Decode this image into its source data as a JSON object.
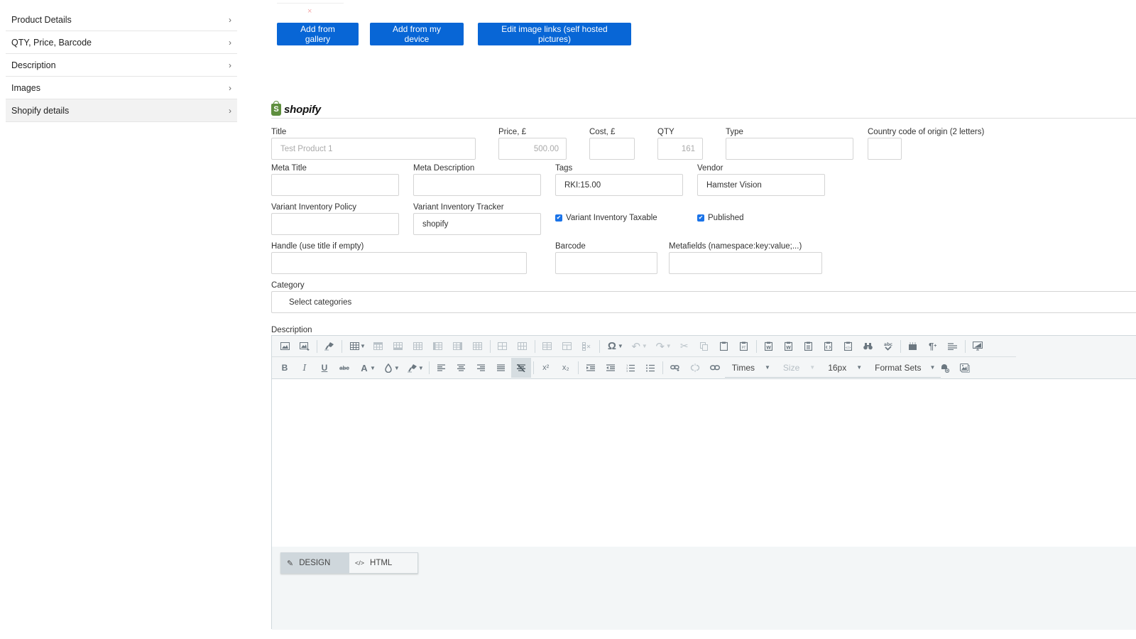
{
  "sidebar": {
    "items": [
      {
        "label": "Product Details",
        "active": false
      },
      {
        "label": "QTY, Price, Barcode",
        "active": false
      },
      {
        "label": "Description",
        "active": false
      },
      {
        "label": "Images",
        "active": false
      },
      {
        "label": "Shopify details",
        "active": true
      }
    ],
    "chevron": "›"
  },
  "images": {
    "remove_glyph": "×",
    "buttons": {
      "add_gallery": "Add from gallery",
      "add_device": "Add from my device",
      "edit_links": "Edit image links (self hosted pictures)"
    }
  },
  "shopify": {
    "logo_text": "shopify",
    "logo_glyph": "S",
    "fields": {
      "title": {
        "label": "Title",
        "value": "Test Product 1"
      },
      "price": {
        "label": "Price, £",
        "value": "500.00"
      },
      "cost": {
        "label": "Cost, £",
        "value": ""
      },
      "qty": {
        "label": "QTY",
        "value": "161"
      },
      "type": {
        "label": "Type",
        "value": ""
      },
      "country": {
        "label": "Country code of origin (2 letters)",
        "value": ""
      },
      "meta_title": {
        "label": "Meta Title",
        "value": ""
      },
      "meta_description": {
        "label": "Meta Description",
        "value": ""
      },
      "tags": {
        "label": "Tags",
        "value": "RKI:15.00"
      },
      "vendor": {
        "label": "Vendor",
        "value": "Hamster Vision"
      },
      "variant_inventory_policy": {
        "label": "Variant Inventory Policy",
        "value": ""
      },
      "variant_inventory_tracker": {
        "label": "Variant Inventory Tracker",
        "value": "shopify"
      },
      "handle": {
        "label": "Handle (use title if empty)",
        "value": ""
      },
      "barcode": {
        "label": "Barcode",
        "value": ""
      },
      "metafields": {
        "label": "Metafields (namespace:key:value;...)",
        "value": ""
      },
      "category": {
        "label": "Category",
        "value": "Select categories"
      }
    },
    "checkboxes": {
      "variant_inventory_taxable": {
        "label": "Variant Inventory Taxable",
        "checked": true
      },
      "published": {
        "label": "Published",
        "checked": true
      }
    },
    "check_glyph": "✔"
  },
  "description_editor": {
    "label": "Description",
    "font_family": "Times",
    "font_size_placeholder": "Size",
    "font_size_value": "16px",
    "format_sets": "Format Sets",
    "modes": {
      "design": "DESIGN",
      "html": "HTML"
    },
    "active_mode": "design",
    "icons": {
      "pencil": "✎",
      "code": "</>",
      "dropdown": "▼",
      "omega": "Ω",
      "bold": "B",
      "italic": "I",
      "underline": "U",
      "strike": "abc",
      "font_color": "A",
      "superscript": "x²",
      "subscript": "x₂",
      "pilcrow": "¶",
      "undo": "↶",
      "redo": "↷",
      "cut": "✂",
      "find": "⌕",
      "spell": "abc"
    }
  }
}
